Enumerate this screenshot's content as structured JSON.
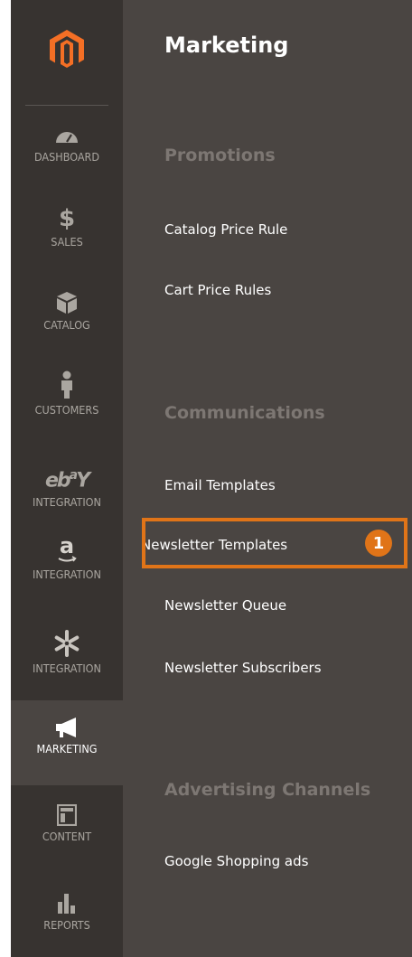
{
  "nav": {
    "items": [
      {
        "label": "DASHBOARD",
        "icon": "dashboard-icon"
      },
      {
        "label": "SALES",
        "icon": "dollar-icon"
      },
      {
        "label": "CATALOG",
        "icon": "box-icon"
      },
      {
        "label": "CUSTOMERS",
        "icon": "person-icon"
      },
      {
        "label": "INTEGRATION",
        "icon": "ebay-icon"
      },
      {
        "label": "INTEGRATION",
        "icon": "amazon-icon"
      },
      {
        "label": "INTEGRATION",
        "icon": "walmart-spark-icon"
      },
      {
        "label": "MARKETING",
        "icon": "megaphone-icon"
      },
      {
        "label": "CONTENT",
        "icon": "layout-icon"
      },
      {
        "label": "REPORTS",
        "icon": "bar-chart-icon"
      }
    ],
    "active": "MARKETING"
  },
  "panel": {
    "title": "Marketing",
    "sections": [
      {
        "title": "Promotions",
        "links": [
          "Catalog Price Rule",
          "Cart Price Rules"
        ]
      },
      {
        "title": "Communications",
        "links": [
          "Email Templates",
          "Newsletter Templates",
          "Newsletter Queue",
          "Newsletter Subscribers"
        ]
      },
      {
        "title": "Advertising Channels",
        "links": [
          "Google Shopping ads"
        ]
      }
    ]
  },
  "callout": {
    "number": "1",
    "target": "Newsletter Templates"
  },
  "colors": {
    "rail": "#373330",
    "panel": "#4a4542",
    "accent": "#e07418",
    "muted": "#7d7773"
  }
}
